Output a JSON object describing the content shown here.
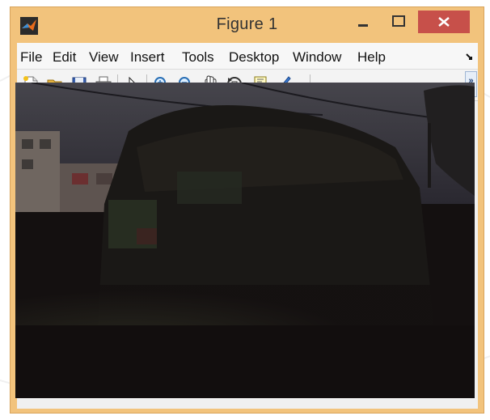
{
  "window": {
    "title": "Figure 1",
    "frame_color": "#f2c37c",
    "close_color": "#c7504a"
  },
  "menu": {
    "items": [
      "File",
      "Edit",
      "View",
      "Insert",
      "Tools",
      "Desktop",
      "Window",
      "Help"
    ],
    "overflow_icon": "double-arrow-icon"
  },
  "toolbar": {
    "buttons": [
      "new-figure-icon",
      "open-file-icon",
      "save-icon",
      "print-icon",
      "select-arrow-icon",
      "zoom-in-icon",
      "zoom-out-icon",
      "pan-hand-icon",
      "rotate-3d-icon",
      "data-cursor-icon",
      "brush-icon",
      "dropdown-arrow-icon"
    ],
    "overflow": "»"
  },
  "figure": {
    "content": "dark-photo",
    "background": "#141010"
  }
}
